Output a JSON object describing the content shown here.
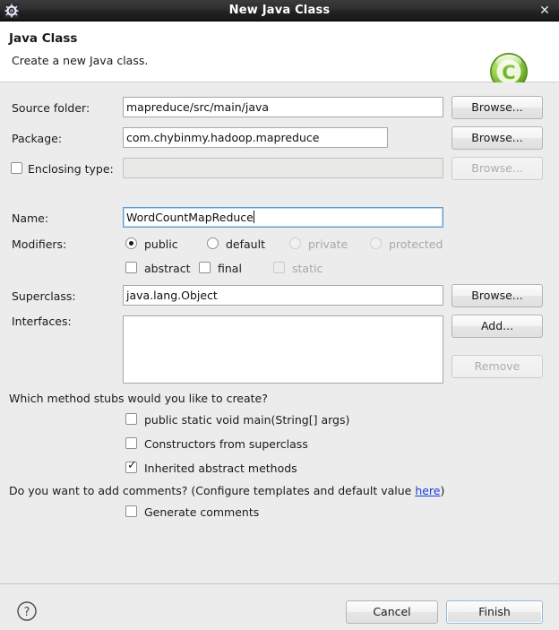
{
  "window": {
    "title": "New Java Class",
    "icon": "gear-icon",
    "close_label": "✕"
  },
  "header": {
    "title": "Java Class",
    "description": "Create a new Java class.",
    "icon": "java-class-green-c-icon"
  },
  "form": {
    "source_folder": {
      "label": "Source folder:",
      "value": "mapreduce/src/main/java",
      "browse_label": "Browse..."
    },
    "package": {
      "label": "Package:",
      "value": "com.chybinmy.hadoop.mapreduce",
      "browse_label": "Browse..."
    },
    "enclosing_type": {
      "label": "Enclosing type:",
      "value": "",
      "checked": false,
      "enabled": false,
      "browse_label": "Browse..."
    },
    "name": {
      "label": "Name:",
      "value": "WordCountMapReduce",
      "focused": true
    },
    "modifiers": {
      "label": "Modifiers:",
      "access": [
        {
          "label": "public",
          "selected": true,
          "enabled": true
        },
        {
          "label": "default",
          "selected": false,
          "enabled": true
        },
        {
          "label": "private",
          "selected": false,
          "enabled": false
        },
        {
          "label": "protected",
          "selected": false,
          "enabled": false
        }
      ],
      "flags": [
        {
          "label": "abstract",
          "checked": false,
          "enabled": true
        },
        {
          "label": "final",
          "checked": false,
          "enabled": true
        },
        {
          "label": "static",
          "checked": false,
          "enabled": false
        }
      ]
    },
    "superclass": {
      "label": "Superclass:",
      "value": "java.lang.Object",
      "browse_label": "Browse..."
    },
    "interfaces": {
      "label": "Interfaces:",
      "items": [],
      "add_label": "Add...",
      "remove_label": "Remove"
    }
  },
  "stubs": {
    "question": "Which method stubs would you like to create?",
    "options": [
      {
        "label": "public static void main(String[] args)",
        "checked": false
      },
      {
        "label": "Constructors from superclass",
        "checked": false
      },
      {
        "label": "Inherited abstract methods",
        "checked": true
      }
    ]
  },
  "comments": {
    "question_prefix": "Do you want to add comments? (Configure templates and default value ",
    "link_label": "here",
    "question_suffix": ")",
    "option": {
      "label": "Generate comments",
      "checked": false
    }
  },
  "footer": {
    "help_label": "?",
    "cancel_label": "Cancel",
    "finish_label": "Finish"
  },
  "colors": {
    "titlebar": "#232323",
    "dialog_bg": "#ececec",
    "header_bg": "#ffffff",
    "link": "#1a3fd4",
    "focus_border": "#5b9ad4",
    "accent_green": "#7cc142"
  }
}
